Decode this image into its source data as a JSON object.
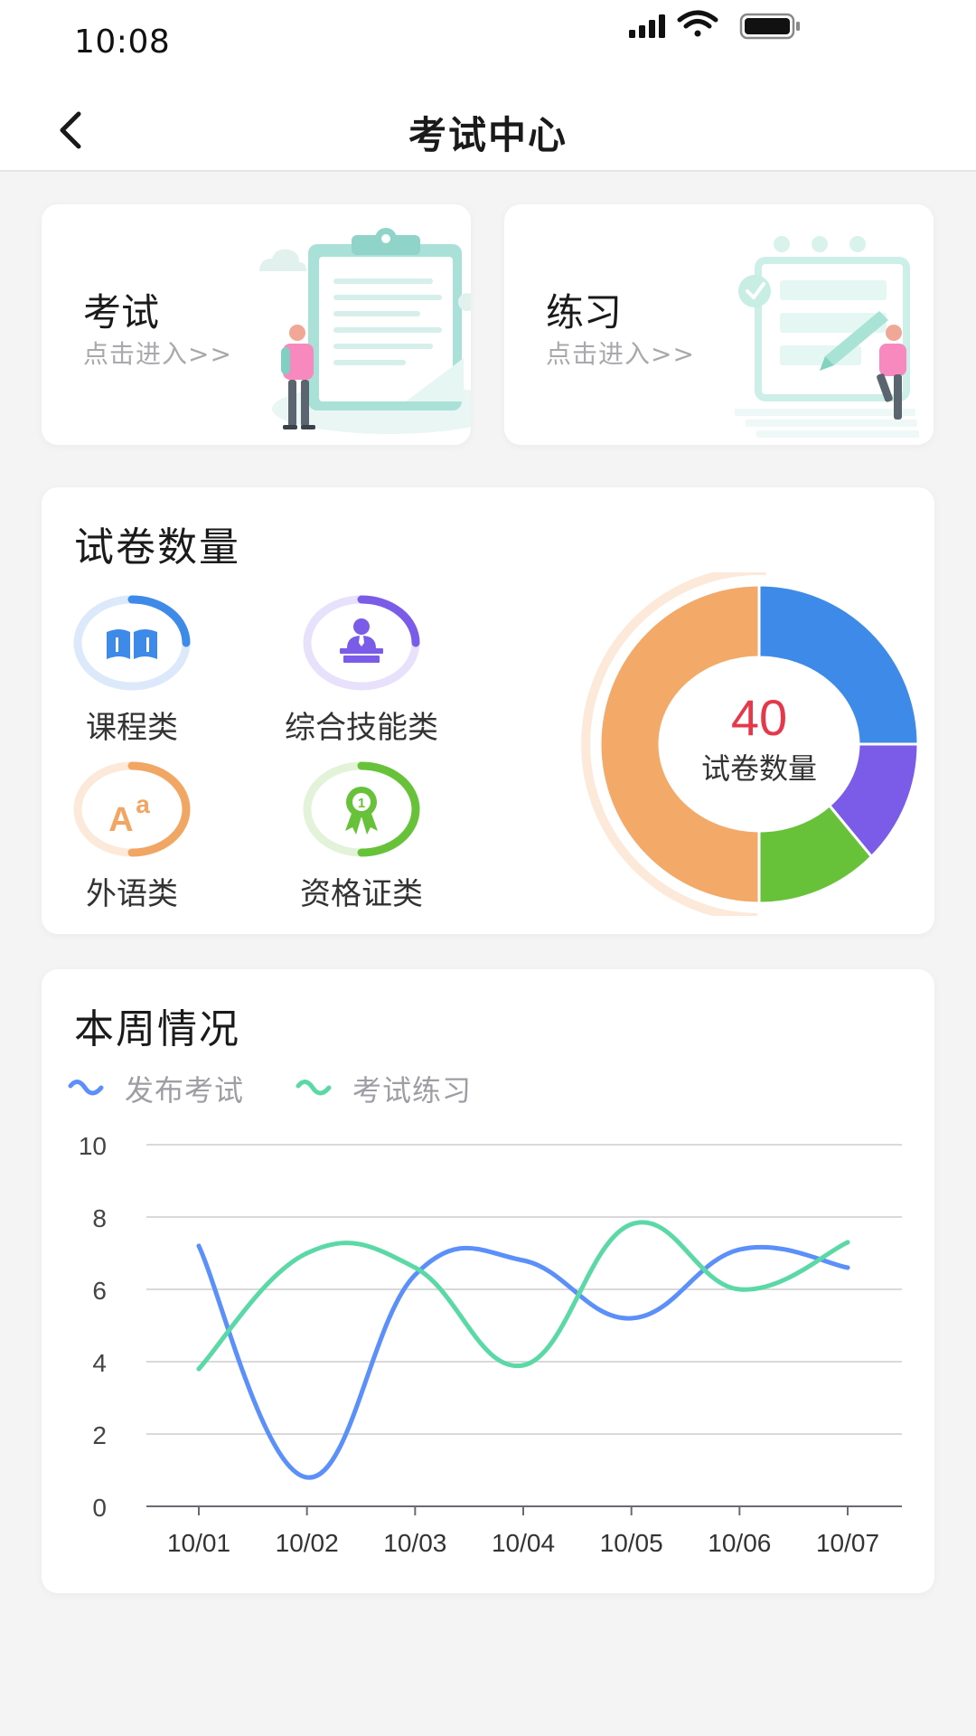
{
  "status_bar": {
    "time": "10:08",
    "icons": [
      "signal-icon",
      "wifi-icon",
      "battery-icon"
    ]
  },
  "nav": {
    "title": "考试中心",
    "back_icon": "chevron-left-icon"
  },
  "entries": [
    {
      "title": "考试",
      "subtitle": "点击进入>>"
    },
    {
      "title": "练习",
      "subtitle": "点击进入>>"
    }
  ],
  "papers": {
    "title": "试卷数量",
    "categories": [
      {
        "label": "课程类",
        "icon": "book-icon",
        "color": "#3d8ae8",
        "track": "#dce9fb",
        "fraction": 0.25
      },
      {
        "label": "综合技能类",
        "icon": "teacher-icon",
        "color": "#7a5ce8",
        "track": "#e7e1fb",
        "fraction": 0.25
      },
      {
        "label": "外语类",
        "icon": "language-icon",
        "color": "#f2a664",
        "track": "#fde9da",
        "fraction": 0.5
      },
      {
        "label": "资格证类",
        "icon": "award-ribbon-icon",
        "color": "#67c23a",
        "track": "#e3f3da",
        "fraction": 0.5
      }
    ],
    "donut": {
      "total": "40",
      "label": "试卷数量",
      "segments": [
        {
          "name": "课程类",
          "value": 10,
          "color": "#3d8ae8"
        },
        {
          "name": "综合技能类",
          "value": 5,
          "color": "#7a5ce8"
        },
        {
          "name": "资格证类",
          "value": 5,
          "color": "#67c23a"
        },
        {
          "name": "外语类",
          "value": 20,
          "color": "#f3a968"
        }
      ]
    }
  },
  "week": {
    "title": "本周情况"
  },
  "chart_data": {
    "type": "line",
    "categories": [
      "10/01",
      "10/02",
      "10/03",
      "10/04",
      "10/05",
      "10/06",
      "10/07"
    ],
    "series": [
      {
        "name": "发布考试",
        "color": "#5b8ff9",
        "values": [
          7.2,
          0.8,
          6.4,
          6.8,
          5.2,
          7.1,
          6.6
        ]
      },
      {
        "name": "考试练习",
        "color": "#5ad8a6",
        "values": [
          3.8,
          7.0,
          6.6,
          3.9,
          7.8,
          6.0,
          7.3
        ]
      }
    ],
    "yticks": [
      "0",
      "2",
      "4",
      "6",
      "8",
      "10"
    ],
    "ylim": [
      0,
      10
    ],
    "grid": true,
    "legend": "top-left"
  }
}
